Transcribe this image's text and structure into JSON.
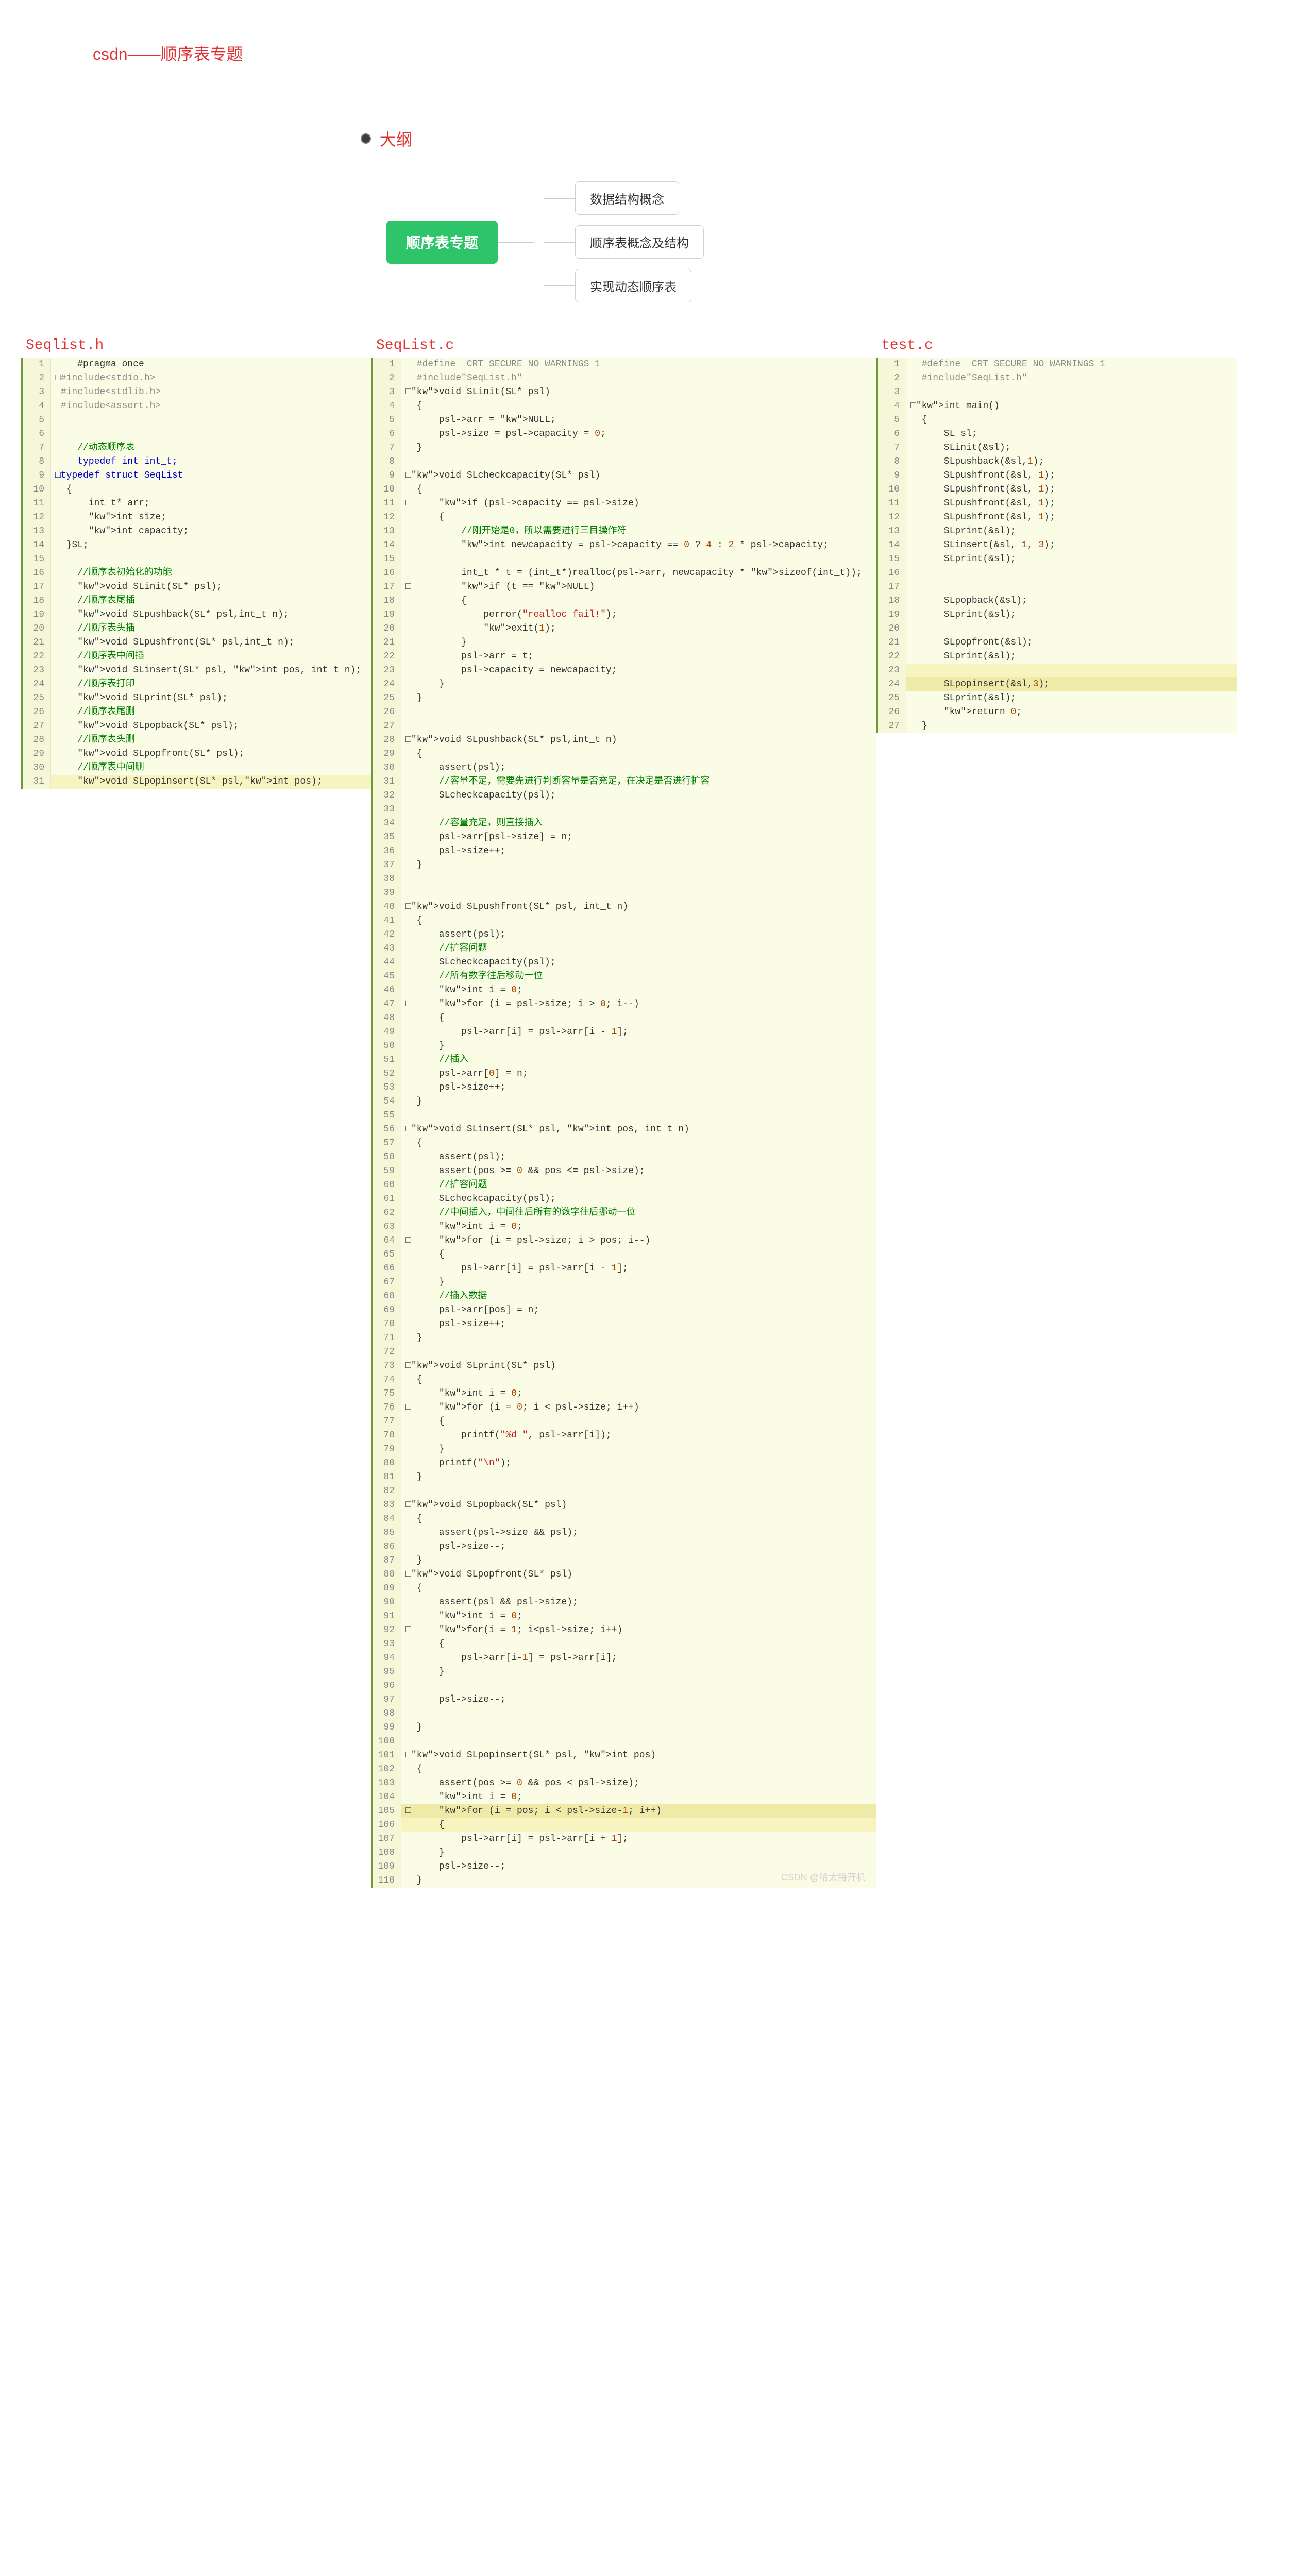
{
  "page": {
    "title": "csdn——顺序表专题",
    "outline_label": "大纲"
  },
  "mindmap": {
    "root": "顺序表专题",
    "children": [
      "数据结构概念",
      "顺序表概念及结构",
      "实现动态顺序表"
    ]
  },
  "files": {
    "h": {
      "title": "Seqlist.h",
      "lines": [
        {
          "n": "1",
          "c": "    #pragma once"
        },
        {
          "n": "2",
          "c": "□#include<stdio.h>",
          "cls": "pp"
        },
        {
          "n": "3",
          "c": " #include<stdlib.h>",
          "cls": "pp"
        },
        {
          "n": "4",
          "c": " #include<assert.h>",
          "cls": "pp"
        },
        {
          "n": "5",
          "c": ""
        },
        {
          "n": "6",
          "c": ""
        },
        {
          "n": "7",
          "c": "    //动态顺序表",
          "cls": "cm"
        },
        {
          "n": "8",
          "c": "    typedef int int_t;",
          "cls": "kw"
        },
        {
          "n": "9",
          "c": "□typedef struct SeqList",
          "cls": "kw"
        },
        {
          "n": "10",
          "c": "  {"
        },
        {
          "n": "11",
          "c": "      int_t* arr;"
        },
        {
          "n": "12",
          "c": "      int size;"
        },
        {
          "n": "13",
          "c": "      int capacity;"
        },
        {
          "n": "14",
          "c": "  }SL;"
        },
        {
          "n": "15",
          "c": ""
        },
        {
          "n": "16",
          "c": "    //顺序表初始化的功能",
          "cls": "cm"
        },
        {
          "n": "17",
          "c": "    void SLinit(SL* psl);"
        },
        {
          "n": "18",
          "c": "    //顺序表尾插",
          "cls": "cm"
        },
        {
          "n": "19",
          "c": "    void SLpushback(SL* psl,int_t n);"
        },
        {
          "n": "20",
          "c": "    //顺序表头插",
          "cls": "cm"
        },
        {
          "n": "21",
          "c": "    void SLpushfront(SL* psl,int_t n);"
        },
        {
          "n": "22",
          "c": "    //顺序表中间插",
          "cls": "cm"
        },
        {
          "n": "23",
          "c": "    void SLinsert(SL* psl, int pos, int_t n);"
        },
        {
          "n": "24",
          "c": "    //顺序表打印",
          "cls": "cm"
        },
        {
          "n": "25",
          "c": "    void SLprint(SL* psl);"
        },
        {
          "n": "26",
          "c": "    //顺序表尾删",
          "cls": "cm"
        },
        {
          "n": "27",
          "c": "    void SLpopback(SL* psl);"
        },
        {
          "n": "28",
          "c": "    //顺序表头删",
          "cls": "cm"
        },
        {
          "n": "29",
          "c": "    void SLpopfront(SL* psl);"
        },
        {
          "n": "30",
          "c": "    //顺序表中间删",
          "cls": "cm"
        },
        {
          "n": "31",
          "c": "    void SLpopinsert(SL* psl,int pos);",
          "hl": true
        }
      ]
    },
    "c": {
      "title": "SeqList.c",
      "lines": [
        {
          "n": "1",
          "c": "  #define _CRT_SECURE_NO_WARNINGS 1",
          "cls": "pp"
        },
        {
          "n": "2",
          "c": "  #include\"SeqList.h\"",
          "cls": "pp"
        },
        {
          "n": "3",
          "c": "□void SLinit(SL* psl)"
        },
        {
          "n": "4",
          "c": "  {"
        },
        {
          "n": "5",
          "c": "      psl->arr = NULL;"
        },
        {
          "n": "6",
          "c": "      psl->size = psl->capacity = 0;"
        },
        {
          "n": "7",
          "c": "  }"
        },
        {
          "n": "8",
          "c": ""
        },
        {
          "n": "9",
          "c": "□void SLcheckcapacity(SL* psl)"
        },
        {
          "n": "10",
          "c": "  {"
        },
        {
          "n": "11",
          "c": "□     if (psl->capacity == psl->size)"
        },
        {
          "n": "12",
          "c": "      {"
        },
        {
          "n": "13",
          "c": "          //刚开始是0，所以需要进行三目操作符",
          "cls": "cm"
        },
        {
          "n": "14",
          "c": "          int newcapacity = psl->capacity == 0 ? 4 : 2 * psl->capacity;"
        },
        {
          "n": "15",
          "c": ""
        },
        {
          "n": "16",
          "c": "          int_t * t = (int_t*)realloc(psl->arr, newcapacity * sizeof(int_t));"
        },
        {
          "n": "17",
          "c": "□         if (t == NULL)"
        },
        {
          "n": "18",
          "c": "          {"
        },
        {
          "n": "19",
          "c": "              perror(\"realloc fail!\");"
        },
        {
          "n": "20",
          "c": "              exit(1);"
        },
        {
          "n": "21",
          "c": "          }"
        },
        {
          "n": "22",
          "c": "          psl->arr = t;"
        },
        {
          "n": "23",
          "c": "          psl->capacity = newcapacity;"
        },
        {
          "n": "24",
          "c": "      }"
        },
        {
          "n": "25",
          "c": "  }"
        },
        {
          "n": "26",
          "c": ""
        },
        {
          "n": "27",
          "c": ""
        },
        {
          "n": "28",
          "c": "□void SLpushback(SL* psl,int_t n)"
        },
        {
          "n": "29",
          "c": "  {"
        },
        {
          "n": "30",
          "c": "      assert(psl);"
        },
        {
          "n": "31",
          "c": "      //容量不足，需要先进行判断容量是否充足，在决定是否进行扩容",
          "cls": "cm"
        },
        {
          "n": "32",
          "c": "      SLcheckcapacity(psl);"
        },
        {
          "n": "33",
          "c": ""
        },
        {
          "n": "34",
          "c": "      //容量充足，则直接插入",
          "cls": "cm"
        },
        {
          "n": "35",
          "c": "      psl->arr[psl->size] = n;"
        },
        {
          "n": "36",
          "c": "      psl->size++;"
        },
        {
          "n": "37",
          "c": "  }"
        },
        {
          "n": "38",
          "c": ""
        },
        {
          "n": "39",
          "c": ""
        },
        {
          "n": "40",
          "c": "□void SLpushfront(SL* psl, int_t n)"
        },
        {
          "n": "41",
          "c": "  {"
        },
        {
          "n": "42",
          "c": "      assert(psl);"
        },
        {
          "n": "43",
          "c": "      //扩容问题",
          "cls": "cm"
        },
        {
          "n": "44",
          "c": "      SLcheckcapacity(psl);"
        },
        {
          "n": "45",
          "c": "      //所有数字往后移动一位",
          "cls": "cm"
        },
        {
          "n": "46",
          "c": "      int i = 0;"
        },
        {
          "n": "47",
          "c": "□     for (i = psl->size; i > 0; i--)"
        },
        {
          "n": "48",
          "c": "      {"
        },
        {
          "n": "49",
          "c": "          psl->arr[i] = psl->arr[i - 1];"
        },
        {
          "n": "50",
          "c": "      }"
        },
        {
          "n": "51",
          "c": "      //插入",
          "cls": "cm"
        },
        {
          "n": "52",
          "c": "      psl->arr[0] = n;"
        },
        {
          "n": "53",
          "c": "      psl->size++;"
        },
        {
          "n": "54",
          "c": "  }"
        },
        {
          "n": "55",
          "c": ""
        },
        {
          "n": "56",
          "c": "□void SLinsert(SL* psl, int pos, int_t n)"
        },
        {
          "n": "57",
          "c": "  {"
        },
        {
          "n": "58",
          "c": "      assert(psl);"
        },
        {
          "n": "59",
          "c": "      assert(pos >= 0 && pos <= psl->size);"
        },
        {
          "n": "60",
          "c": "      //扩容问题",
          "cls": "cm"
        },
        {
          "n": "61",
          "c": "      SLcheckcapacity(psl);"
        },
        {
          "n": "62",
          "c": "      //中间插入，中间往后所有的数字往后挪动一位",
          "cls": "cm"
        },
        {
          "n": "63",
          "c": "      int i = 0;"
        },
        {
          "n": "64",
          "c": "□     for (i = psl->size; i > pos; i--)"
        },
        {
          "n": "65",
          "c": "      {"
        },
        {
          "n": "66",
          "c": "          psl->arr[i] = psl->arr[i - 1];"
        },
        {
          "n": "67",
          "c": "      }"
        },
        {
          "n": "68",
          "c": "      //插入数据",
          "cls": "cm"
        },
        {
          "n": "69",
          "c": "      psl->arr[pos] = n;"
        },
        {
          "n": "70",
          "c": "      psl->size++;"
        },
        {
          "n": "71",
          "c": "  }"
        },
        {
          "n": "72",
          "c": ""
        },
        {
          "n": "73",
          "c": "□void SLprint(SL* psl)"
        },
        {
          "n": "74",
          "c": "  {"
        },
        {
          "n": "75",
          "c": "      int i = 0;"
        },
        {
          "n": "76",
          "c": "□     for (i = 0; i < psl->size; i++)"
        },
        {
          "n": "77",
          "c": "      {"
        },
        {
          "n": "78",
          "c": "          printf(\"%d \", psl->arr[i]);"
        },
        {
          "n": "79",
          "c": "      }"
        },
        {
          "n": "80",
          "c": "      printf(\"\\n\");"
        },
        {
          "n": "81",
          "c": "  }"
        },
        {
          "n": "82",
          "c": ""
        },
        {
          "n": "83",
          "c": "□void SLpopback(SL* psl)"
        },
        {
          "n": "84",
          "c": "  {"
        },
        {
          "n": "85",
          "c": "      assert(psl->size && psl);"
        },
        {
          "n": "86",
          "c": "      psl->size--;"
        },
        {
          "n": "87",
          "c": "  }"
        },
        {
          "n": "88",
          "c": "□void SLpopfront(SL* psl)"
        },
        {
          "n": "89",
          "c": "  {"
        },
        {
          "n": "90",
          "c": "      assert(psl && psl->size);"
        },
        {
          "n": "91",
          "c": "      int i = 0;"
        },
        {
          "n": "92",
          "c": "□     for(i = 1; i<psl->size; i++)"
        },
        {
          "n": "93",
          "c": "      {"
        },
        {
          "n": "94",
          "c": "          psl->arr[i-1] = psl->arr[i];"
        },
        {
          "n": "95",
          "c": "      }"
        },
        {
          "n": "96",
          "c": ""
        },
        {
          "n": "97",
          "c": "      psl->size--;"
        },
        {
          "n": "98",
          "c": ""
        },
        {
          "n": "99",
          "c": "  }"
        },
        {
          "n": "100",
          "c": ""
        },
        {
          "n": "101",
          "c": "□void SLpopinsert(SL* psl, int pos)"
        },
        {
          "n": "102",
          "c": "  {"
        },
        {
          "n": "103",
          "c": "      assert(pos >= 0 && pos < psl->size);"
        },
        {
          "n": "104",
          "c": "      int i = 0;"
        },
        {
          "n": "105",
          "c": "□     for (i = pos; i < psl->size-1; i++)",
          "hl2": true
        },
        {
          "n": "106",
          "c": "      {",
          "hl": true
        },
        {
          "n": "107",
          "c": "          psl->arr[i] = psl->arr[i + 1];"
        },
        {
          "n": "108",
          "c": "      }"
        },
        {
          "n": "109",
          "c": "      psl->size--;"
        },
        {
          "n": "110",
          "c": "  }"
        }
      ]
    },
    "t": {
      "title": "test.c",
      "lines": [
        {
          "n": "1",
          "c": "  #define _CRT_SECURE_NO_WARNINGS 1",
          "cls": "pp"
        },
        {
          "n": "2",
          "c": "  #include\"SeqList.h\"",
          "cls": "pp"
        },
        {
          "n": "3",
          "c": ""
        },
        {
          "n": "4",
          "c": "□int main()"
        },
        {
          "n": "5",
          "c": "  {"
        },
        {
          "n": "6",
          "c": "      SL sl;"
        },
        {
          "n": "7",
          "c": "      SLinit(&sl);"
        },
        {
          "n": "8",
          "c": "      SLpushback(&sl,1);"
        },
        {
          "n": "9",
          "c": "      SLpushfront(&sl, 1);"
        },
        {
          "n": "10",
          "c": "      SLpushfront(&sl, 1);"
        },
        {
          "n": "11",
          "c": "      SLpushfront(&sl, 1);"
        },
        {
          "n": "12",
          "c": "      SLpushfront(&sl, 1);"
        },
        {
          "n": "13",
          "c": "      SLprint(&sl);"
        },
        {
          "n": "14",
          "c": "      SLinsert(&sl, 1, 3);"
        },
        {
          "n": "15",
          "c": "      SLprint(&sl);"
        },
        {
          "n": "16",
          "c": ""
        },
        {
          "n": "17",
          "c": ""
        },
        {
          "n": "18",
          "c": "      SLpopback(&sl);"
        },
        {
          "n": "19",
          "c": "      SLprint(&sl);"
        },
        {
          "n": "20",
          "c": ""
        },
        {
          "n": "21",
          "c": "      SLpopfront(&sl);"
        },
        {
          "n": "22",
          "c": "      SLprint(&sl);"
        },
        {
          "n": "23",
          "c": "",
          "hl": true
        },
        {
          "n": "24",
          "c": "      SLpopinsert(&sl,3);",
          "hl2": true
        },
        {
          "n": "25",
          "c": "      SLprint(&sl);"
        },
        {
          "n": "26",
          "c": "      return 0;"
        },
        {
          "n": "27",
          "c": "  }"
        }
      ]
    }
  },
  "watermark": "CSDN @哈太特开机"
}
